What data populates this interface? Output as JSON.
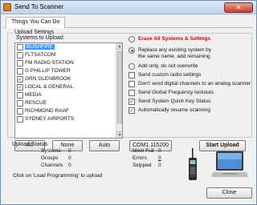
{
  "window": {
    "title": "Send To Scanner",
    "close_icon": "close-icon"
  },
  "tab": "Things You Can Do",
  "upload_settings": {
    "group_label": "Upload Settings",
    "systems_label": "Systems to Upload",
    "systems": [
      {
        "label": "BUSHFIRE",
        "checked": false,
        "selected": true
      },
      {
        "label": "FLTSATCOM",
        "checked": false,
        "selected": false
      },
      {
        "label": "FM RADIO STATION",
        "checked": false,
        "selected": false
      },
      {
        "label": "G PHILLIP TOWER",
        "checked": false,
        "selected": false
      },
      {
        "label": "GRN GLENBROOK",
        "checked": true,
        "selected": false
      },
      {
        "label": "LOCAL & GENERAL",
        "checked": true,
        "selected": false
      },
      {
        "label": "MEDIA",
        "checked": false,
        "selected": false
      },
      {
        "label": "RESCUE",
        "checked": false,
        "selected": false
      },
      {
        "label": "RICHMOND RAAF",
        "checked": false,
        "selected": false
      },
      {
        "label": "SYDNEY AIRPORTS",
        "checked": false,
        "selected": false
      }
    ],
    "buttons": {
      "all": "All",
      "none": "None",
      "auto": "Auto",
      "com_port": "COM1 115200",
      "start_upload": "Start Upload"
    },
    "radio_options": {
      "erase": "Erase All Systems & Settings",
      "replace_line1": "Replace any existing system by",
      "replace_line2": "the same name, add remaining",
      "add_only": "Add only, do not overwrite",
      "selected": "replace"
    },
    "check_options": [
      {
        "label": "Send custom radio settings",
        "checked": false
      },
      {
        "label": "Don't send digital channels to an analog scanner",
        "checked": false
      },
      {
        "label": "Send Global Frequency lockouts",
        "checked": false
      },
      {
        "label": "Send System Quick Key Status",
        "checked": true
      },
      {
        "label": "Automatically resume scanning",
        "checked": true
      }
    ]
  },
  "upload_status": {
    "group_label": "Upload Status",
    "systems_label": "Systems",
    "systems_value": "0",
    "groups_label": "Groups",
    "groups_value": "0",
    "channels_label": "Channels",
    "channels_value": "0",
    "mem_full_label": "Mem Full",
    "mem_full_value": "0",
    "errors_label": "Errors",
    "errors_value": "0",
    "skipped_label": "Skipped",
    "skipped_value": "0",
    "hint": "Click on 'Load Programming' to upload"
  },
  "footer": {
    "close": "Close"
  },
  "icons": {
    "scanner": "handheld-scanner-icon",
    "laptop": "laptop-icon"
  }
}
